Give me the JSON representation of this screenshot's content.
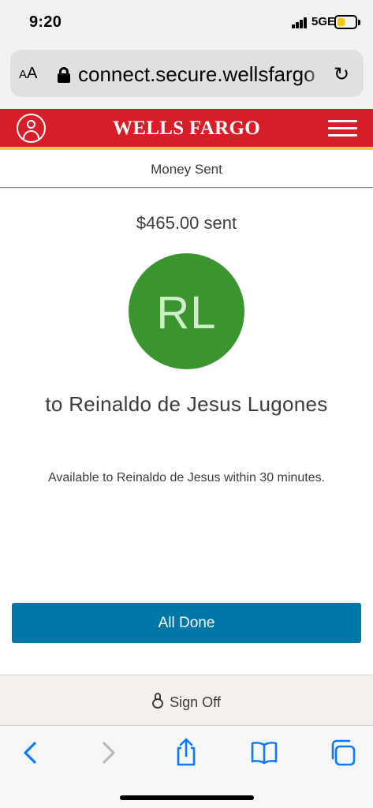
{
  "status_bar": {
    "time": "9:20",
    "network": "5GE"
  },
  "browser": {
    "aa_label_small": "A",
    "aa_label_large": "A",
    "url": "connect.secure.wellsfargo",
    "icons": {
      "lock": "lock-icon",
      "reload": "reload-icon"
    }
  },
  "header": {
    "logo": "WELLS FARGO",
    "brand_color": "#d71e28",
    "stripe_color": "#ffcd41"
  },
  "page": {
    "title": "Money Sent",
    "amount_text": "$465.00 sent",
    "avatar_initials": "RL",
    "avatar_color": "#3a952f",
    "recipient_text": "to Reinaldo de Jesus Lugones",
    "availability_text": "Available to Reinaldo de Jesus within 30 minutes.",
    "done_button": "All Done",
    "button_color": "#0077a9"
  },
  "footer": {
    "sign_off": "Sign Off"
  },
  "toolbar": {
    "icons": [
      "back-icon",
      "forward-icon",
      "share-icon",
      "bookmarks-icon",
      "tabs-icon"
    ],
    "accent": "#0a7aff"
  }
}
